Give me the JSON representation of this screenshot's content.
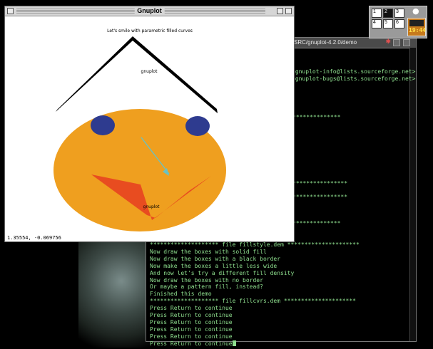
{
  "gnuplot_window": {
    "title": "Gnuplot",
    "plot_title": "Let's smile with parametric filled curves",
    "hat_label": "gnuplot",
    "mouth_label": "gnuplot",
    "status_coords": "1.35554, -0.069756",
    "colors": {
      "face": "#EF9F1F",
      "eyes": "#2E3B8F",
      "mouth": "#E84C20",
      "nose": "#6AC2C2",
      "hat": "#000000"
    }
  },
  "terminal": {
    "title": "SRC/gnuplot-4.2.0/demo",
    "fragments": [
      "(gnuplot-info@lists.sourceforge.net>",
      "(gnuplot-bugs@lists.sourceforge.net>",
      "**************",
      "****************",
      "****************",
      "**************"
    ],
    "lines": [
      "******************** file fillstyle.dem *********************",
      "Now draw the boxes with solid fill",
      "Now draw the boxes with a black border",
      "Now make the boxes a little less wide",
      "And now let's try a different fill density",
      "Now draw the boxes with no border",
      "Or maybe a pattern fill, instead?",
      "Finished this demo",
      "******************** file fillcvrs.dem *********************",
      "Press Return to continue",
      "Press Return to continue",
      "Press Return to continue",
      "Press Return to continue",
      "Press Return to continue",
      "Press Return to continue"
    ]
  },
  "pager": {
    "desktops": [
      "1",
      "2",
      "3",
      "4",
      "5",
      "6"
    ],
    "active": "2"
  },
  "clock": {
    "time": "19:44"
  }
}
